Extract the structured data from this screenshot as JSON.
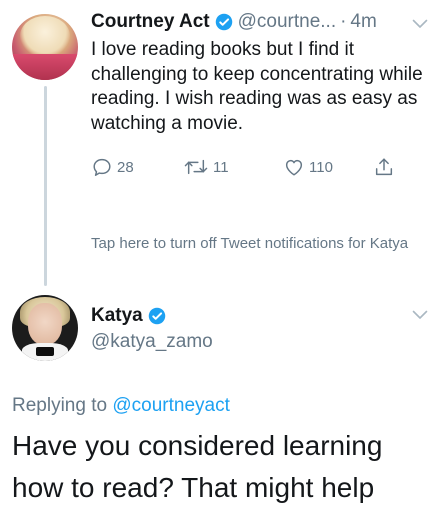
{
  "tweet1": {
    "name": "Courtney Act",
    "handle": "@courtne...",
    "separator": "·",
    "time": "4m",
    "text": "I love reading books but I find it challenging to keep concentrating while reading. I wish reading was as easy as watching a movie.",
    "replies": "28",
    "retweets": "11",
    "likes": "110",
    "notification": "Tap here to turn off Tweet notifications for Katya"
  },
  "tweet2": {
    "name": "Katya",
    "handle": "@katya_zamo",
    "replying_prefix": "Replying to ",
    "replying_to": "@courtneyact",
    "text": "Have you considered learning how to read? That might help"
  },
  "icons": {
    "verified": "verified-badge-icon",
    "chevron": "chevron-down-icon",
    "reply": "reply-icon",
    "retweet": "retweet-icon",
    "like": "heart-icon",
    "share": "share-icon"
  },
  "colors": {
    "verified": "#1da1f2",
    "text": "#14171a",
    "muted": "#657786",
    "mention": "#1da1f2",
    "thread_line": "#ccd6dd"
  }
}
